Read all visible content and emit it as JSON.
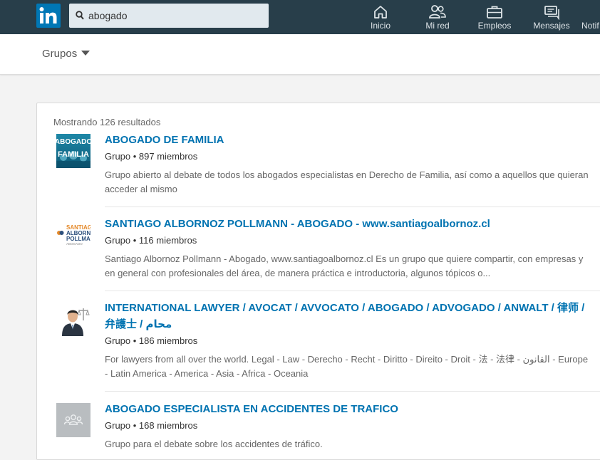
{
  "search": {
    "query": "abogado"
  },
  "nav": [
    {
      "label": "Inicio",
      "icon": "home-icon"
    },
    {
      "label": "Mi red",
      "icon": "people-icon"
    },
    {
      "label": "Empleos",
      "icon": "briefcase-icon"
    },
    {
      "label": "Mensajes",
      "icon": "messages-icon"
    },
    {
      "label": "Notif",
      "icon": "notifications-icon"
    }
  ],
  "filter": {
    "label": "Grupos"
  },
  "results_count": "Mostrando 126 resultados",
  "colors": {
    "topbar": "#283e4a",
    "brand": "#0077b5",
    "link": "#0073b1"
  },
  "results": [
    {
      "title": "ABOGADO DE FAMILIA",
      "meta": "Grupo • 897 miembros",
      "desc": "Grupo abierto al debate de todos los abogados especialistas en Derecho de Familia, así como a aquellos que quieran acceder al mismo",
      "thumb_text": "ABOGADO FAMILIA"
    },
    {
      "title": "SANTIAGO ALBORNOZ POLLMANN - ABOGADO - www.santiagoalbornoz.cl",
      "meta": "Grupo • 116 miembros",
      "desc": "Santiago Albornoz Pollmann - Abogado, www.santiagoalbornoz.cl Es un grupo que quiere compartir, con empresas y en general con profesionales del área, de manera práctica e introductoria, algunos tópicos o...",
      "thumb_text": "SANTIAGO ALBORNOZ POLLMANN ABOGADO"
    },
    {
      "title": "INTERNATIONAL LAWYER / AVOCAT / AVVOCATO / ABOGADO / ADVOGADO / ANWALT / 律师 / 弁護士 / محام",
      "meta": "Grupo • 186 miembros",
      "desc": "For lawyers from all over the world. Legal - Law - Derecho - Recht - Diritto - Direito - Droit - 法 - 法律 - القانون - Europe - Latin America - America - Asia - Africa - Oceania"
    },
    {
      "title": "ABOGADO ESPECIALISTA EN ACCIDENTES DE TRAFICO",
      "meta": "Grupo • 168 miembros",
      "desc": "Grupo para el debate sobre los accidentes de tráfico."
    }
  ]
}
